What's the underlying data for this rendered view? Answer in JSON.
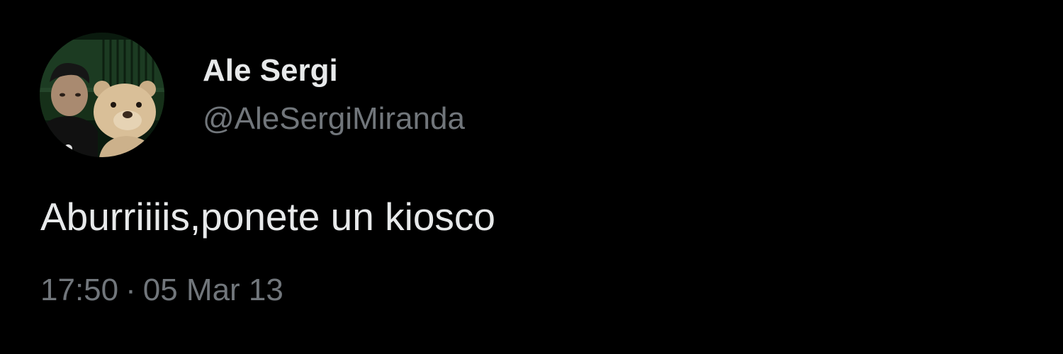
{
  "author": {
    "display_name": "Ale Sergi",
    "handle": "@AleSergiMiranda",
    "avatar": "avatar-photo-man-with-teddy-bear"
  },
  "tweet": {
    "text": "Aburriiiis,ponete un kiosco",
    "time": "17:50",
    "separator": "·",
    "date": "05 Mar 13"
  },
  "colors": {
    "background": "#000000",
    "primary_text": "#e7e9ea",
    "secondary_text": "#71767b"
  }
}
